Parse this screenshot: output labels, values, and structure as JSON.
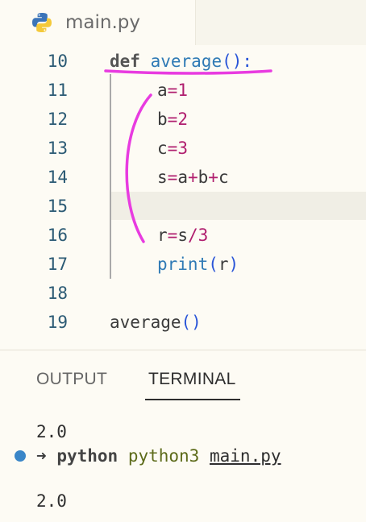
{
  "tab": {
    "filename": "main.py",
    "icon": "python-icon"
  },
  "editor": {
    "lines": [
      {
        "num": "10"
      },
      {
        "num": "11"
      },
      {
        "num": "12"
      },
      {
        "num": "13"
      },
      {
        "num": "14"
      },
      {
        "num": "15"
      },
      {
        "num": "16"
      },
      {
        "num": "17"
      },
      {
        "num": "18"
      },
      {
        "num": "19"
      }
    ],
    "code": {
      "l10_kw": "def",
      "l10_fn": "average",
      "l10_paren": "()",
      "l10_colon": ":",
      "l11_var": "a",
      "l11_op": "=",
      "l11_num": "1",
      "l12_var": "b",
      "l12_op": "=",
      "l12_num": "2",
      "l13_var": "c",
      "l13_op": "=",
      "l13_num": "3",
      "l14_s": "s",
      "l14_eq": "=",
      "l14_a": "a",
      "l14_p1": "+",
      "l14_b": "b",
      "l14_p2": "+",
      "l14_c": "c",
      "l16_r": "r",
      "l16_eq": "=",
      "l16_s": "s",
      "l16_div": "/",
      "l16_num": "3",
      "l17_fn": "print",
      "l17_open": "(",
      "l17_arg": "r",
      "l17_close": ")",
      "l19_call": "average",
      "l19_paren": "()"
    },
    "annotation_color": "#e83be0"
  },
  "panel": {
    "tabs": {
      "output": "OUTPUT",
      "terminal": "TERMINAL"
    },
    "terminal": {
      "out1": "2.0",
      "arrow": "➜",
      "prompt_dir": "python",
      "cmd": "python3",
      "file": "main.py",
      "out2": "2.0"
    }
  }
}
